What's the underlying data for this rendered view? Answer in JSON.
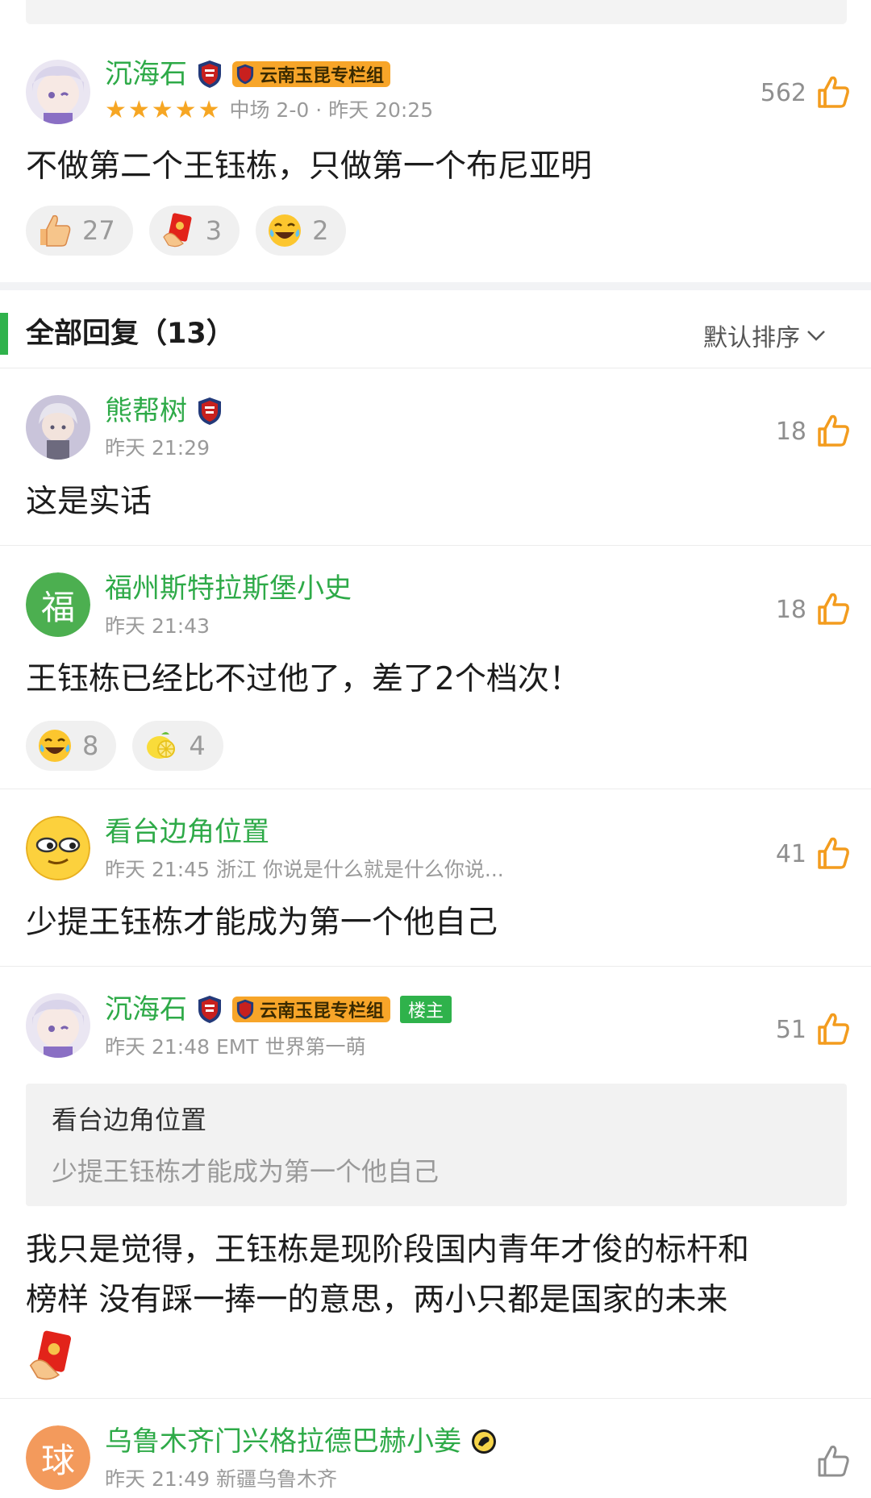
{
  "top_comment": {
    "username": "沉海石",
    "column_badge": "云南玉昆专栏组",
    "rating_stars": 5,
    "meta": "中场 2-0 · 昨天 20:25",
    "likes": "562",
    "text": "不做第二个王钰栋，只做第一个布尼亚明",
    "reactions": [
      {
        "icon": "thumbs-up-emoji-icon",
        "count": "27"
      },
      {
        "icon": "red-card-emoji-icon",
        "count": "3"
      },
      {
        "icon": "laughing-tears-emoji-icon",
        "count": "2"
      }
    ]
  },
  "section": {
    "title": "全部回复（13）",
    "sort_label": "默认排序"
  },
  "replies": [
    {
      "username": "熊帮树",
      "meta": "昨天 21:29",
      "likes": "18",
      "text": "这是实话"
    },
    {
      "avatar_char": "福",
      "username": "福州斯特拉斯堡小史",
      "meta": "昨天 21:43",
      "likes": "18",
      "text": "王钰栋已经比不过他了，差了2个档次！",
      "reactions": [
        {
          "icon": "laughing-tears-emoji-icon",
          "count": "8"
        },
        {
          "icon": "lemon-emoji-icon",
          "count": "4"
        }
      ]
    },
    {
      "username": "看台边角位置",
      "meta": "昨天 21:45 浙江 你说是什么就是什么你说...",
      "likes": "41",
      "text": "少提王钰栋才能成为第一个他自己"
    },
    {
      "username": "沉海石",
      "column_badge": "云南玉昆专栏组",
      "owner_badge": "楼主",
      "meta": "昨天 21:48 EMT 世界第一萌",
      "likes": "51",
      "quote": {
        "name": "看台边角位置",
        "text": "少提王钰栋才能成为第一个他自己"
      },
      "text_line1": "我只是觉得，王钰栋是现阶段国内青年才俊的标杆和",
      "text_line2": "榜样 没有踩一捧一的意思，两小只都是国家的未来"
    },
    {
      "avatar_char": "球",
      "username": "乌鲁木齐门兴格拉德巴赫小姜",
      "meta": "昨天 21:49 新疆乌鲁木齐"
    }
  ],
  "colors": {
    "accent_green": "#2fb24b",
    "like_orange": "#f39c1e",
    "badge_orange": "#f7a529",
    "meta_gray": "#9a9a9a"
  }
}
